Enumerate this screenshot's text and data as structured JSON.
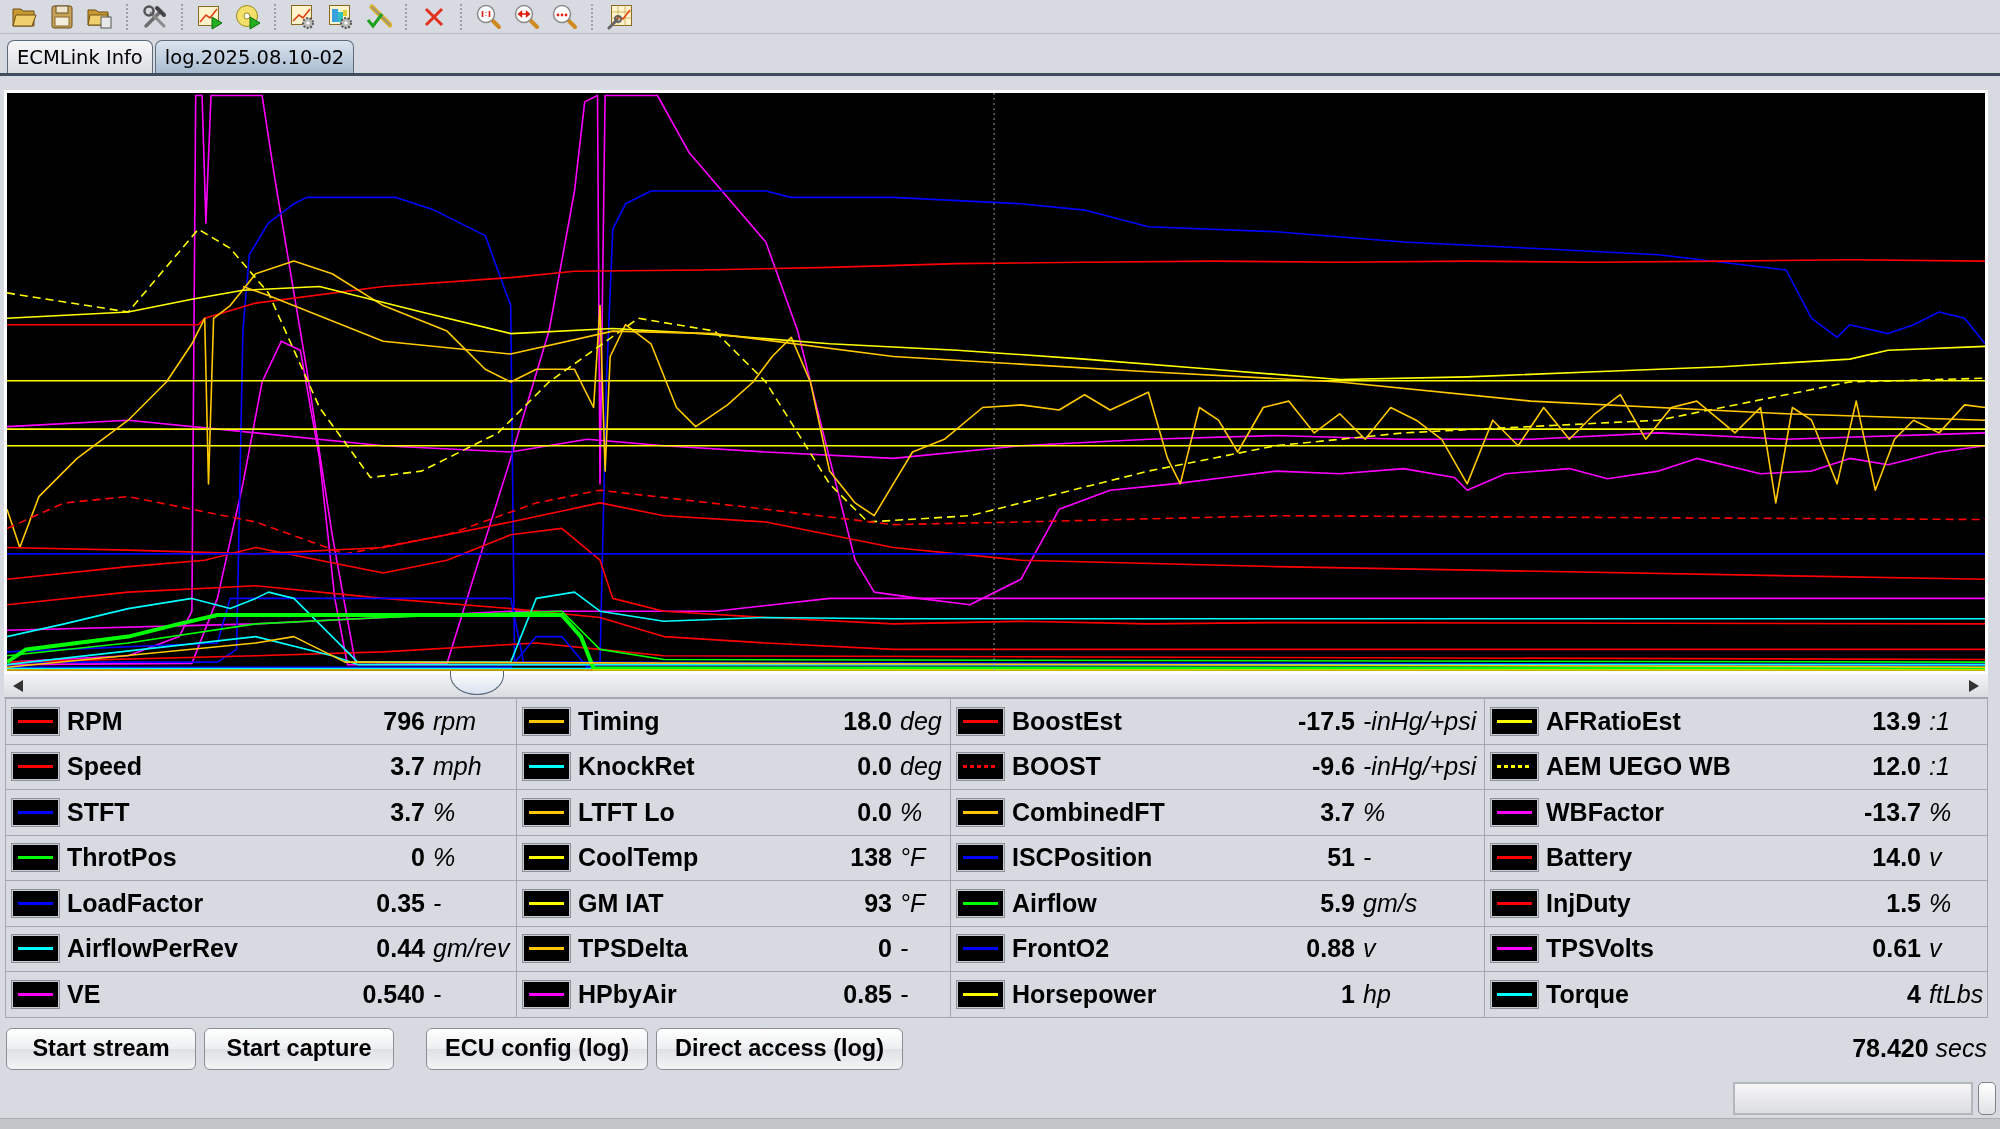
{
  "tabs": [
    {
      "label": "ECMLink Info",
      "selected": false
    },
    {
      "label": "log.2025.08.10-02",
      "selected": true
    }
  ],
  "channels": [
    {
      "name": "RPM",
      "value": "796",
      "unit": "rpm",
      "color": "#ff0000",
      "dashed": false
    },
    {
      "name": "Timing",
      "value": "18.0",
      "unit": "deg",
      "color": "#ffc800",
      "dashed": false
    },
    {
      "name": "BoostEst",
      "value": "-17.5",
      "unit": "-inHg/+psi",
      "color": "#ff0000",
      "dashed": false
    },
    {
      "name": "AFRatioEst",
      "value": "13.9",
      "unit": ":1",
      "color": "#ffff00",
      "dashed": false
    },
    {
      "name": "Speed",
      "value": "3.7",
      "unit": "mph",
      "color": "#ff0000",
      "dashed": false
    },
    {
      "name": "KnockRet",
      "value": "0.0",
      "unit": "deg",
      "color": "#00ffff",
      "dashed": false
    },
    {
      "name": "BOOST",
      "value": "-9.6",
      "unit": "-inHg/+psi",
      "color": "#ff0000",
      "dashed": true
    },
    {
      "name": "AEM UEGO WB",
      "value": "12.0",
      "unit": ":1",
      "color": "#ffff00",
      "dashed": true
    },
    {
      "name": "STFT",
      "value": "3.7",
      "unit": "%",
      "color": "#0000ff",
      "dashed": false
    },
    {
      "name": "LTFT Lo",
      "value": "0.0",
      "unit": "%",
      "color": "#ffc800",
      "dashed": false
    },
    {
      "name": "CombinedFT",
      "value": "3.7",
      "unit": "%",
      "color": "#ffc800",
      "dashed": false
    },
    {
      "name": "WBFactor",
      "value": "-13.7",
      "unit": "%",
      "color": "#ff00ff",
      "dashed": false
    },
    {
      "name": "ThrotPos",
      "value": "0",
      "unit": "%",
      "color": "#00ff00",
      "dashed": false
    },
    {
      "name": "CoolTemp",
      "value": "138",
      "unit": "°F",
      "color": "#ffff00",
      "dashed": false
    },
    {
      "name": "ISCPosition",
      "value": "51",
      "unit": "-",
      "color": "#0000ff",
      "dashed": false
    },
    {
      "name": "Battery",
      "value": "14.0",
      "unit": "v",
      "color": "#ff0000",
      "dashed": false
    },
    {
      "name": "LoadFactor",
      "value": "0.35",
      "unit": "-",
      "color": "#0000ff",
      "dashed": false
    },
    {
      "name": "GM IAT",
      "value": "93",
      "unit": "°F",
      "color": "#ffff00",
      "dashed": false
    },
    {
      "name": "Airflow",
      "value": "5.9",
      "unit": "gm/s",
      "color": "#00ff00",
      "dashed": false
    },
    {
      "name": "InjDuty",
      "value": "1.5",
      "unit": "%",
      "color": "#ff0000",
      "dashed": false
    },
    {
      "name": "AirflowPerRev",
      "value": "0.44",
      "unit": "gm/rev",
      "color": "#00ffff",
      "dashed": false
    },
    {
      "name": "TPSDelta",
      "value": "0",
      "unit": "-",
      "color": "#ffc800",
      "dashed": false
    },
    {
      "name": "FrontO2",
      "value": "0.88",
      "unit": "v",
      "color": "#0000ff",
      "dashed": false
    },
    {
      "name": "TPSVolts",
      "value": "0.61",
      "unit": "v",
      "color": "#ff00ff",
      "dashed": false
    },
    {
      "name": "VE",
      "value": "0.540",
      "unit": "-",
      "color": "#ff00ff",
      "dashed": false
    },
    {
      "name": "HPbyAir",
      "value": "0.85",
      "unit": "-",
      "color": "#ff00ff",
      "dashed": false
    },
    {
      "name": "Horsepower",
      "value": "1",
      "unit": "hp",
      "color": "#ffff00",
      "dashed": false
    },
    {
      "name": "Torque",
      "value": "4",
      "unit": "ftLbs",
      "color": "#00ffff",
      "dashed": false
    }
  ],
  "buttons": [
    {
      "label": "Start stream"
    },
    {
      "label": "Start capture"
    },
    {
      "label": "ECU config (log)"
    },
    {
      "label": "Direct access (log)"
    }
  ],
  "elapsed": {
    "value": "78.420",
    "unit": "secs"
  }
}
